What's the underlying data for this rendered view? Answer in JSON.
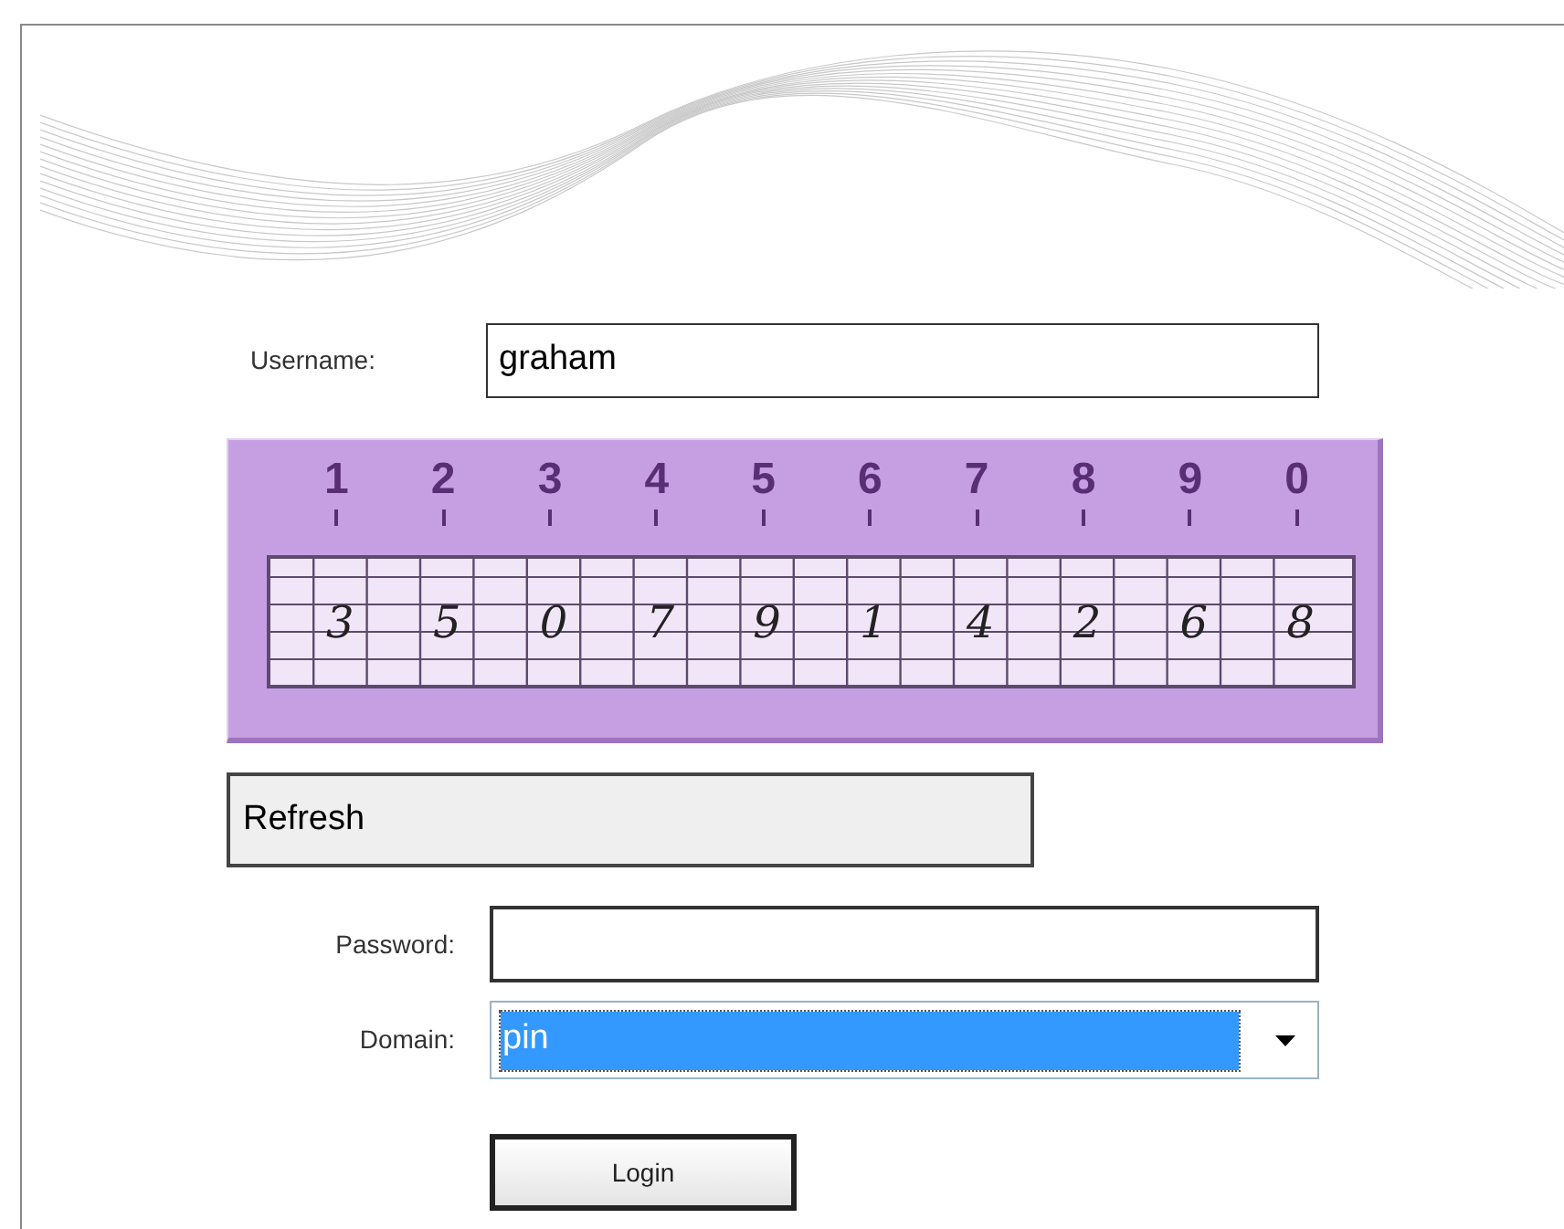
{
  "username": {
    "label": "Username:",
    "value": "graham"
  },
  "keypad": {
    "keys": [
      "1",
      "2",
      "3",
      "4",
      "5",
      "6",
      "7",
      "8",
      "9",
      "0"
    ],
    "codes": [
      "3",
      "5",
      "0",
      "7",
      "9",
      "1",
      "4",
      "2",
      "6",
      "8"
    ]
  },
  "refresh_button": "Refresh",
  "password": {
    "label": "Password:"
  },
  "domain": {
    "label": "Domain:",
    "value": "pin",
    "highlighted": true
  },
  "login_button": "Login"
}
